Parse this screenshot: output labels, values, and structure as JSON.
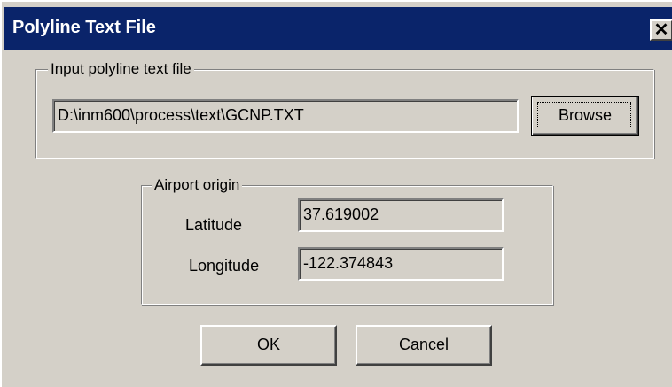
{
  "window": {
    "title": "Polyline Text File",
    "close_glyph": "✕",
    "close_icon": "close-icon"
  },
  "input_group": {
    "label": "Input polyline text file",
    "path_value": "D:\\inm600\\process\\text\\GCNP.TXT",
    "browse_label": "Browse"
  },
  "origin_group": {
    "label": "Airport origin",
    "latitude_label": "Latitude",
    "latitude_value": "37.619002",
    "longitude_label": "Longitude",
    "longitude_value": "-122.374843"
  },
  "buttons": {
    "ok_label": "OK",
    "cancel_label": "Cancel"
  },
  "colors": {
    "titlebar": "#0a246a",
    "face": "#d4d0c8",
    "title_text": "#ffffff"
  }
}
